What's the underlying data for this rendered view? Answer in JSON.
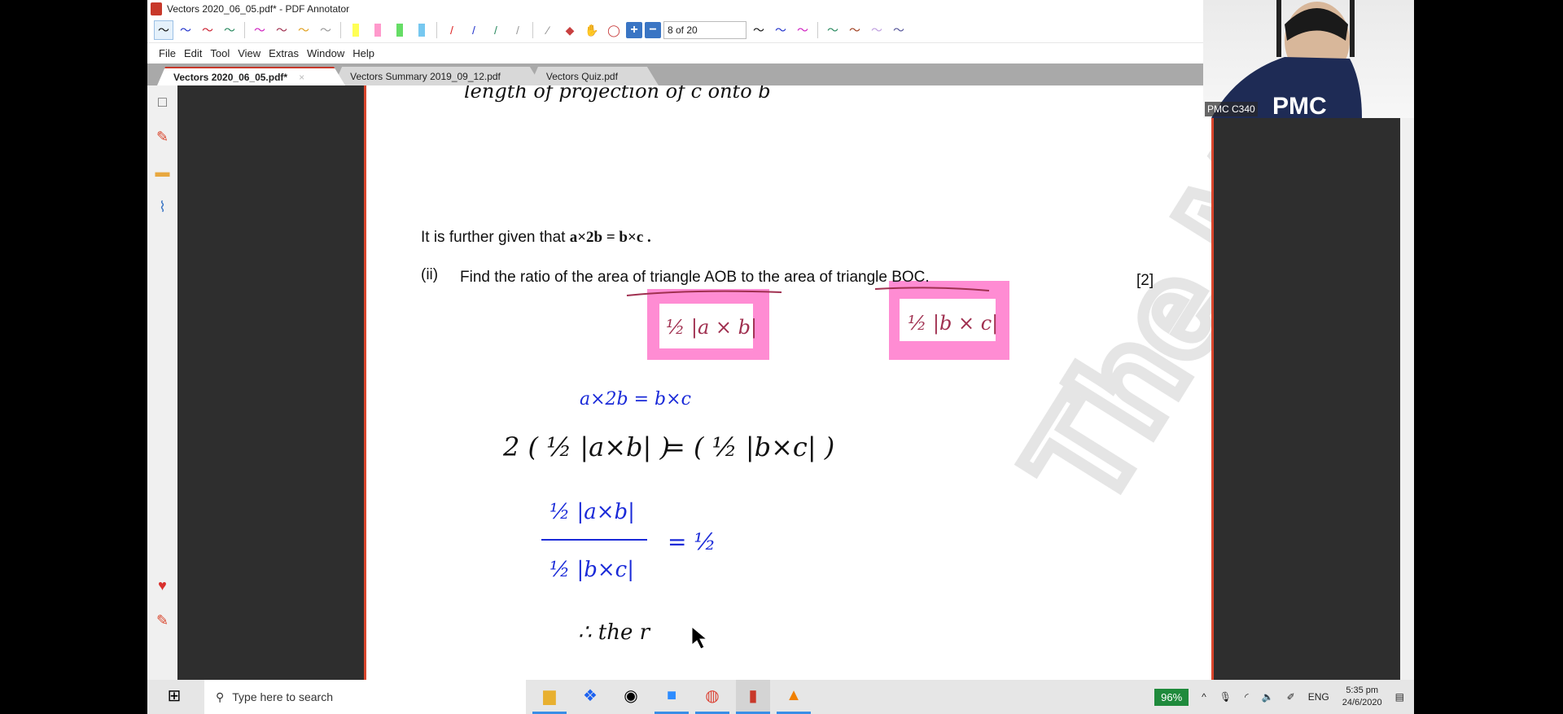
{
  "window": {
    "title": "Vectors 2020_06_05.pdf* - PDF Annotator"
  },
  "toolbar": {
    "page_indicator": "8 of 20",
    "pen_colors": [
      "#111111",
      "#2233cc",
      "#cc2233",
      "#2a8a60",
      "#d020c0",
      "#a03050",
      "#e0a020",
      "#999999"
    ],
    "highlighter_colors": [
      "#ffff55",
      "#ff99cc",
      "#66dd66",
      "#77c8f0"
    ],
    "line_colors": [
      "#dd2222",
      "#2233cc",
      "#2a8a60",
      "#999999"
    ],
    "extra_pen_colors": [
      "#111111",
      "#2233cc",
      "#d020c0",
      "#2a8a60",
      "#a04020",
      "#c0a0e0",
      "#555599"
    ]
  },
  "menu": [
    "File",
    "Edit",
    "Tool",
    "View",
    "Extras",
    "Window",
    "Help"
  ],
  "tabs": [
    {
      "label": "Vectors 2020_06_05.pdf*",
      "active": true
    },
    {
      "label": "Vectors Summary 2019_09_12.pdf",
      "active": false
    },
    {
      "label": "Vectors Quiz.pdf",
      "active": false
    }
  ],
  "document": {
    "given_text": "It is further given that",
    "given_math": "a×2b = b×c .",
    "part_label": "(ii)",
    "question": "Find the ratio of the area of triangle AOB to the area of triangle BOC.",
    "marks": "[2]"
  },
  "annotations": {
    "top_note": "length of projection of c onto b",
    "box1": "½ |a × b|",
    "box2": "½ |b × c|",
    "line1": "a×2b = b×c",
    "line2_left": "2 ( ½ |a×b| )",
    "line2_right": "= ( ½ |b×c| )",
    "frac_num": "½ |a×b|",
    "frac_den": "½ |b×c|",
    "frac_rhs": "= ½",
    "conclusion": "∴  the  r"
  },
  "watermark": "The Maths Cafe",
  "webcam": {
    "label": "PMC C340"
  },
  "taskbar": {
    "search_placeholder": "Type here to search",
    "battery": "96%",
    "language": "ENG",
    "time": "5:35 pm",
    "date": "24/6/2020"
  }
}
